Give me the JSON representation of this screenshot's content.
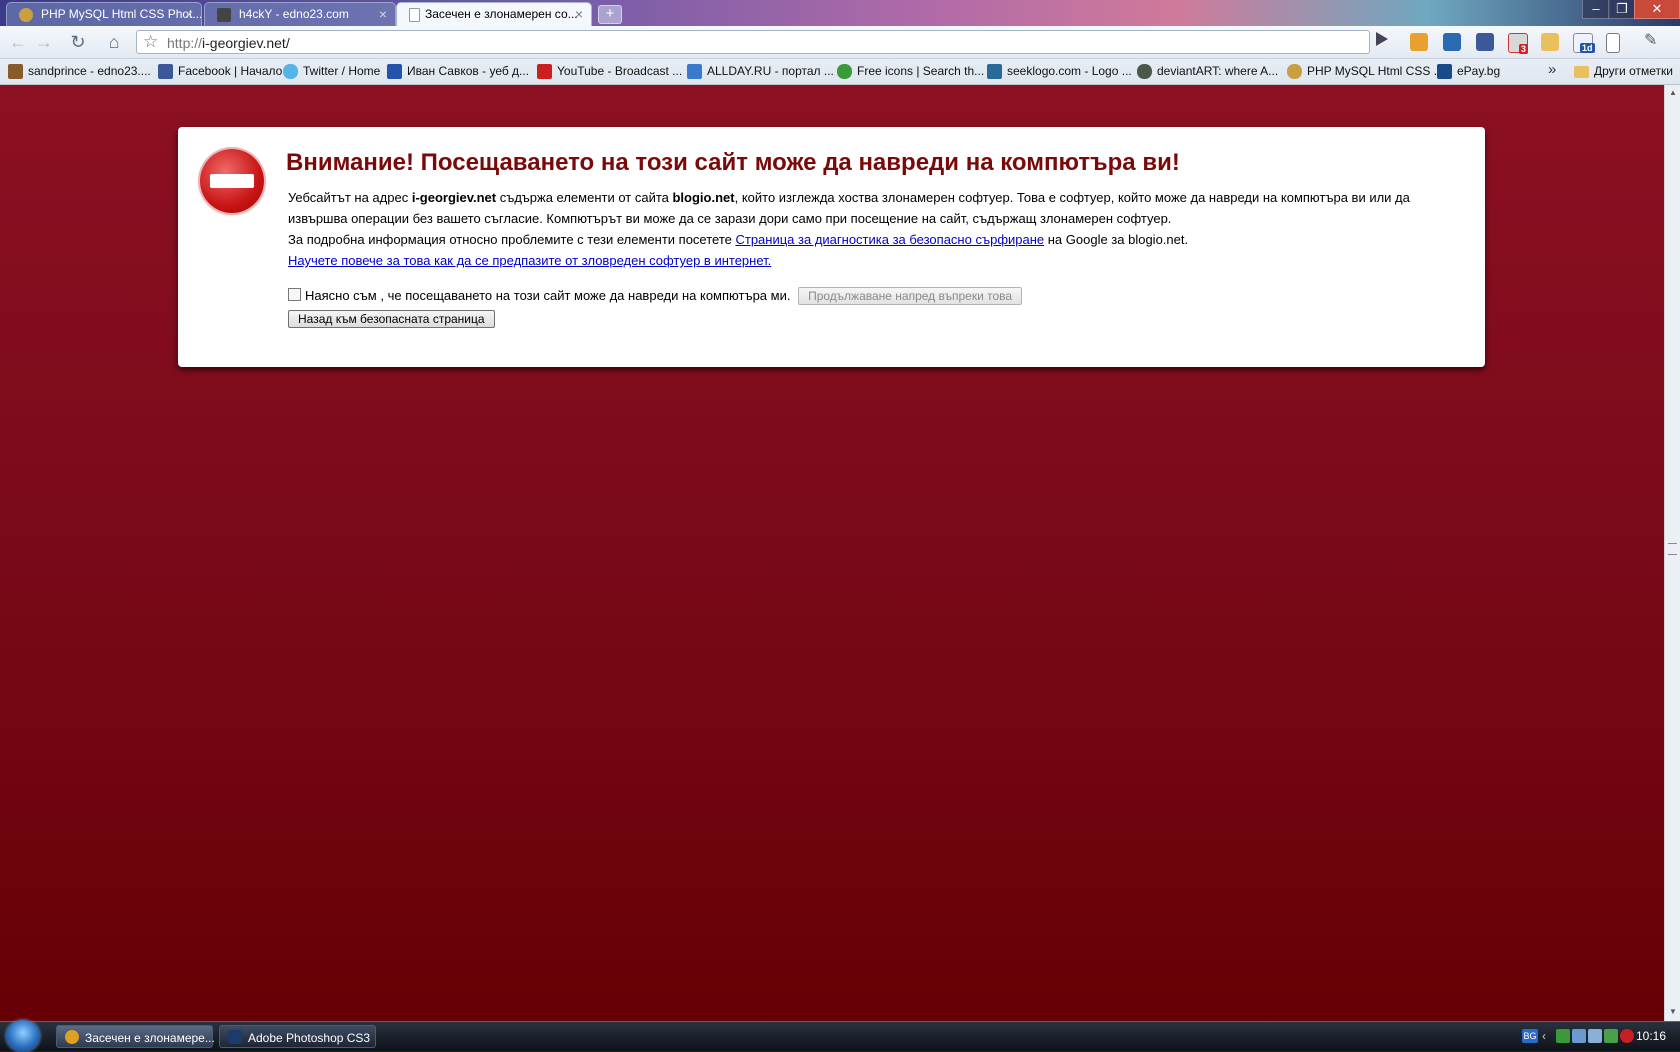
{
  "tabs": [
    {
      "label": "PHP MySQL Html CSS Phot...",
      "color": "#c8a040"
    },
    {
      "label": "h4ckY - edno23.com",
      "color": "#444444"
    },
    {
      "label": "Засечен е злонамерен со...",
      "color": "#ffffff"
    }
  ],
  "toolbar": {
    "url_scheme": "http://",
    "url_host": "i-georgiev.net/"
  },
  "bookmarks": [
    {
      "label": "sandprince - edno23....",
      "color": "#8a5a2a"
    },
    {
      "label": "Facebook | Начало",
      "color": "#3b5998"
    },
    {
      "label": "Twitter / Home",
      "color": "#55b4e6"
    },
    {
      "label": "Иван Савков - уеб д...",
      "color": "#2255aa"
    },
    {
      "label": "YouTube - Broadcast ...",
      "color": "#cc2020"
    },
    {
      "label": "ALLDAY.RU - портал ...",
      "color": "#3a7acc"
    },
    {
      "label": "Free icons | Search th...",
      "color": "#3a9a3a"
    },
    {
      "label": "seeklogo.com - Logo ...",
      "color": "#2a6a9a"
    },
    {
      "label": "deviantART: where A...",
      "color": "#4a5a4a"
    },
    {
      "label": "PHP MySQL Html CSS ...",
      "color": "#c8a040"
    },
    {
      "label": "ePay.bg",
      "color": "#1a4a8a"
    }
  ],
  "other_bookmarks": "Други отметки",
  "warning": {
    "title": "Внимание! Посещаването на този сайт може да навреди на компютъра ви!",
    "p1_a": "Уебсайтът на адрес ",
    "site": "i-georgiev.net",
    "p1_b": " съдържа елементи от сайта ",
    "malware_site": "blogio.net",
    "p1_c": ", който изглежда хоства злонамерен софтуер. Това е софтуер, който може да навреди на компютъра ви или да извършва операции без вашето съгласие. Компютърът ви може да се зарази дори само при посещение на сайт, съдържащ злонамерен софтуер.",
    "p2_a": "За подробна информация относно проблемите с тези елементи посетете ",
    "p2_link": "Страница за диагностика за безопасно сърфиране",
    "p2_b": " на Google за blogio.net.",
    "learn_more": "Научете повече за това как да се предпазите от зловреден софтуер в интернет.",
    "consent_label": "Наясно съм , че посещаването на този сайт може да навреди на компютъра ми.",
    "proceed_button": "Продължаване напред въпреки това",
    "back_button": "Назад към безопасната страница"
  },
  "taskbar": {
    "items": [
      {
        "label": "Засечен е злонамере...",
        "color": "#e0a020"
      },
      {
        "label": "Adobe Photoshop CS3",
        "color": "#1c3a6a"
      }
    ],
    "language": "BG",
    "clock": "10:16"
  },
  "colors": {
    "page_background": "#7b0a1a",
    "title_color": "#7a0a0a",
    "link_color": "#0000cc"
  }
}
